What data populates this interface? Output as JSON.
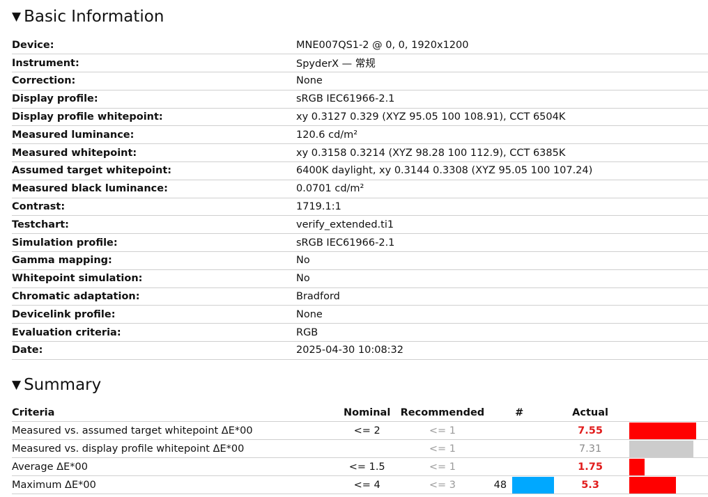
{
  "basic": {
    "title": "Basic Information",
    "triangle": "▼",
    "rows": [
      {
        "label": "Device:",
        "value": "MNE007QS1-2 @ 0, 0, 1920x1200"
      },
      {
        "label": "Instrument:",
        "value": "SpyderX — 常规"
      },
      {
        "label": "Correction:",
        "value": "None"
      },
      {
        "label": "Display profile:",
        "value": "sRGB IEC61966-2.1"
      },
      {
        "label": "Display profile whitepoint:",
        "value": "xy 0.3127 0.329 (XYZ 95.05 100 108.91), CCT 6504K"
      },
      {
        "label": "Measured luminance:",
        "value": "120.6 cd/m²"
      },
      {
        "label": "Measured whitepoint:",
        "value": "xy 0.3158 0.3214 (XYZ 98.28 100 112.9), CCT 6385K"
      },
      {
        "label": "Assumed target whitepoint:",
        "value": "6400K daylight, xy 0.3144 0.3308 (XYZ 95.05 100 107.24)"
      },
      {
        "label": "Measured black luminance:",
        "value": "0.0701 cd/m²"
      },
      {
        "label": "Contrast:",
        "value": "1719.1:1"
      },
      {
        "label": "Testchart:",
        "value": "verify_extended.ti1"
      },
      {
        "label": "Simulation profile:",
        "value": "sRGB IEC61966-2.1"
      },
      {
        "label": "Gamma mapping:",
        "value": "No"
      },
      {
        "label": "Whitepoint simulation:",
        "value": "No"
      },
      {
        "label": "Chromatic adaptation:",
        "value": "Bradford"
      },
      {
        "label": "Devicelink profile:",
        "value": "None"
      },
      {
        "label": "Evaluation criteria:",
        "value": "RGB"
      },
      {
        "label": "Date:",
        "value": "2025-04-30 10:08:32"
      }
    ]
  },
  "summary": {
    "title": "Summary",
    "triangle": "▼",
    "headers": {
      "criteria": "Criteria",
      "nominal": "Nominal",
      "recommended": "Recommended",
      "count": "#",
      "actual": "Actual"
    },
    "rows": [
      {
        "criteria": "Measured vs. assumed target whitepoint ΔE*00",
        "nominal": "<= 2",
        "recommended": "<= 1",
        "count": "",
        "actual": "7.55",
        "status": "bad",
        "bar_fraction": 0.82,
        "bar_color": "#ff0000"
      },
      {
        "criteria": "Measured vs. display profile whitepoint ΔE*00",
        "nominal": "",
        "recommended": "<= 1",
        "count": "",
        "actual": "7.31",
        "status": "na",
        "bar_fraction": 0.79,
        "bar_color": "#cccccc"
      },
      {
        "criteria": "Average ΔE*00",
        "nominal": "<= 1.5",
        "recommended": "<= 1",
        "count": "",
        "actual": "1.75",
        "status": "bad",
        "bar_fraction": 0.19,
        "bar_color": "#ff0000"
      },
      {
        "criteria": "Maximum ΔE*00",
        "nominal": "<= 4",
        "recommended": "<= 3",
        "count": "48",
        "actual": "5.3",
        "status": "bad",
        "bar_fraction": 0.57,
        "bar_color": "#ff0000",
        "count_bar_color": "#00a8ff"
      }
    ]
  }
}
